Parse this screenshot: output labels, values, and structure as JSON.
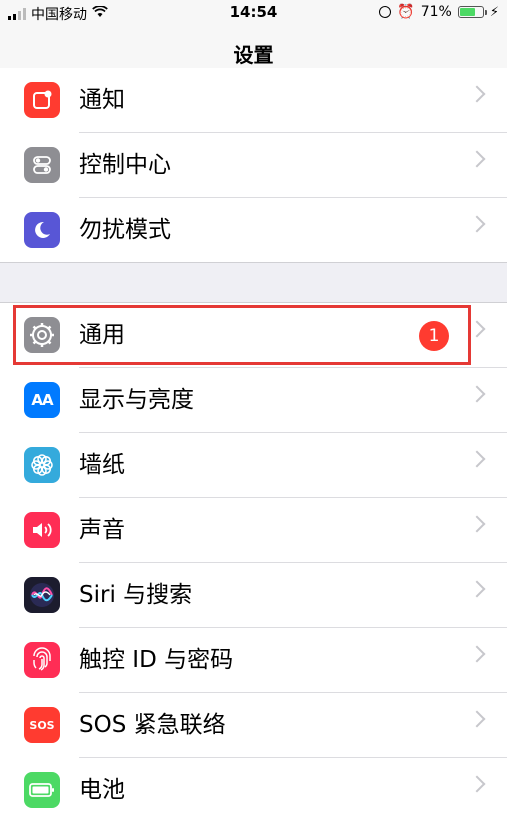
{
  "status_bar": {
    "carrier": "中国移动",
    "time": "14:54",
    "battery_percent": "71%",
    "battery_level": 0.71
  },
  "nav": {
    "title": "设置"
  },
  "section1": [
    {
      "label": "通知",
      "icon": "notifications-icon",
      "color": "#ff3b30"
    },
    {
      "label": "控制中心",
      "icon": "control-center-icon",
      "color": "#8e8e93"
    },
    {
      "label": "勿扰模式",
      "icon": "do-not-disturb-icon",
      "color": "#5856d6"
    }
  ],
  "section2": [
    {
      "label": "通用",
      "icon": "gear-icon",
      "color": "#8e8e93",
      "badge": "1"
    },
    {
      "label": "显示与亮度",
      "icon": "display-brightness-icon",
      "color": "#007aff",
      "icon_text": "AA"
    },
    {
      "label": "墙纸",
      "icon": "wallpaper-icon",
      "color": "#34aadc"
    },
    {
      "label": "声音",
      "icon": "sound-icon",
      "color": "#ff2d55"
    },
    {
      "label": "Siri 与搜索",
      "icon": "siri-icon",
      "color": "#1c1c2e"
    },
    {
      "label": "触控 ID 与密码",
      "icon": "touch-id-icon",
      "color": "#ff2d55"
    },
    {
      "label": "SOS 紧急联络",
      "icon": "sos-icon",
      "color": "#ff3b30",
      "icon_text": "SOS"
    },
    {
      "label": "电池",
      "icon": "battery-icon",
      "color": "#4cd964"
    }
  ]
}
